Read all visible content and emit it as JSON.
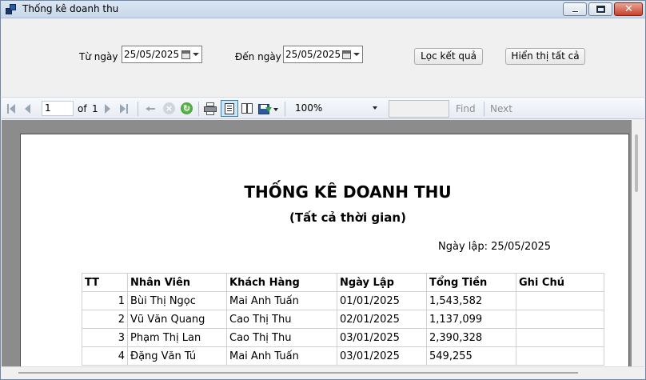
{
  "window": {
    "title": "Thống kê doanh thu"
  },
  "filter": {
    "from_label": "Từ ngày",
    "from_value": "25/05/2025",
    "to_label": "Đến ngày",
    "to_value": "25/05/2025",
    "filter_button": "Lọc kết quả",
    "show_all_button": "Hiển thị tất cả"
  },
  "toolbar": {
    "page_current": "1",
    "of_label": "of",
    "page_total": "1",
    "zoom": "100%",
    "find_label": "Find",
    "next_label": "Next",
    "icons": [
      "first-page-icon",
      "previous-page-icon",
      "next-page-icon",
      "last-page-icon",
      "back-icon",
      "stop-icon",
      "refresh-icon",
      "print-icon",
      "print-layout-icon",
      "page-setup-icon",
      "export-icon"
    ]
  },
  "report": {
    "title": "THỐNG KÊ DOANH THU",
    "subtitle": "(Tất cả thời gian)",
    "created_date": "Ngày lập: 25/05/2025",
    "columns": [
      "TT",
      "Nhân Viên",
      "Khách Hàng",
      "Ngày Lập",
      "Tổng Tiền",
      "Ghi Chú"
    ],
    "rows": [
      {
        "tt": "1",
        "staff": "Bùi Thị Ngọc",
        "customer": "Mai Anh Tuấn",
        "date": "01/01/2025",
        "total": "1,543,582",
        "note": ""
      },
      {
        "tt": "2",
        "staff": "Vũ Văn Quang",
        "customer": "Cao Thị Thu",
        "date": "02/01/2025",
        "total": "1,137,099",
        "note": ""
      },
      {
        "tt": "3",
        "staff": "Phạm Thị Lan",
        "customer": "Cao Thị Thu",
        "date": "03/01/2025",
        "total": "2,390,328",
        "note": ""
      },
      {
        "tt": "4",
        "staff": "Đặng Văn Tú",
        "customer": "Mai Anh Tuấn",
        "date": "03/01/2025",
        "total": "549,255",
        "note": ""
      }
    ]
  },
  "colors": {
    "titlebar": "#c8d7ea",
    "viewer_bg": "#8c8c8c",
    "close_button": "#c9402a"
  }
}
